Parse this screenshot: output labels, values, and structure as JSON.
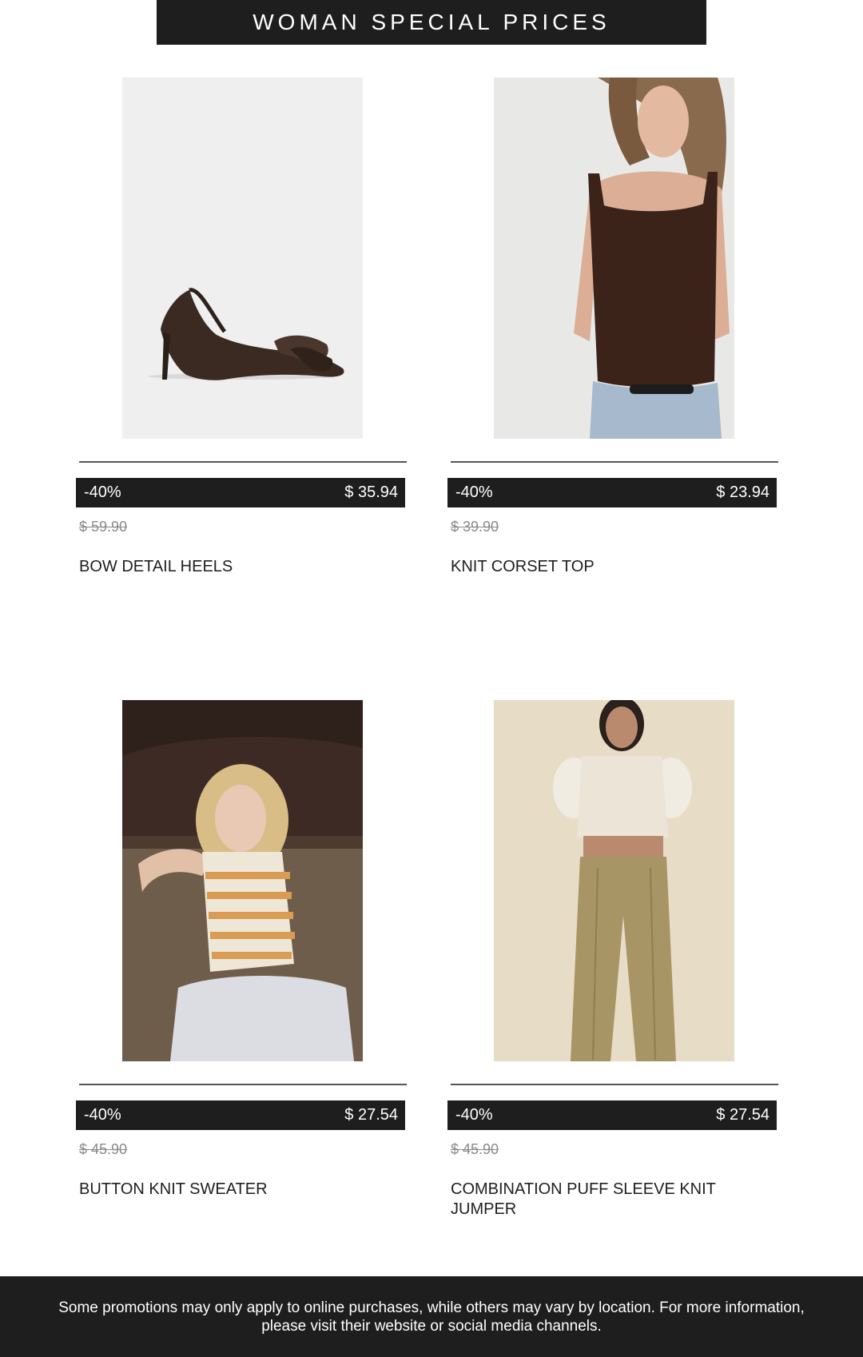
{
  "banner": {
    "title": "WOMAN SPECIAL PRICES"
  },
  "products": [
    {
      "discount": "-40%",
      "price": "$ 35.94",
      "old_price": "$ 59.90",
      "name": "BOW DETAIL HEELS",
      "image": "heels-product-photo"
    },
    {
      "discount": "-40%",
      "price": "$ 23.94",
      "old_price": "$ 39.90",
      "name": "KNIT CORSET TOP",
      "image": "corset-top-model-photo"
    },
    {
      "discount": "-40%",
      "price": "$ 27.54",
      "old_price": "$ 45.90",
      "name": "BUTTON KNIT SWEATER",
      "image": "striped-sweater-model-photo"
    },
    {
      "discount": "-40%",
      "price": "$ 27.54",
      "old_price": "$ 45.90",
      "name": "COMBINATION PUFF SLEEVE KNIT JUMPER",
      "image": "puff-sleeve-jumper-model-photo"
    }
  ],
  "footer": {
    "text": "Some promotions may only apply to online purchases, while others may vary by location. For more information, please visit their website or social media channels."
  },
  "colors": {
    "bar": "#1e1e1e",
    "background": "#ffffff",
    "old_price": "#8a8a8a"
  }
}
